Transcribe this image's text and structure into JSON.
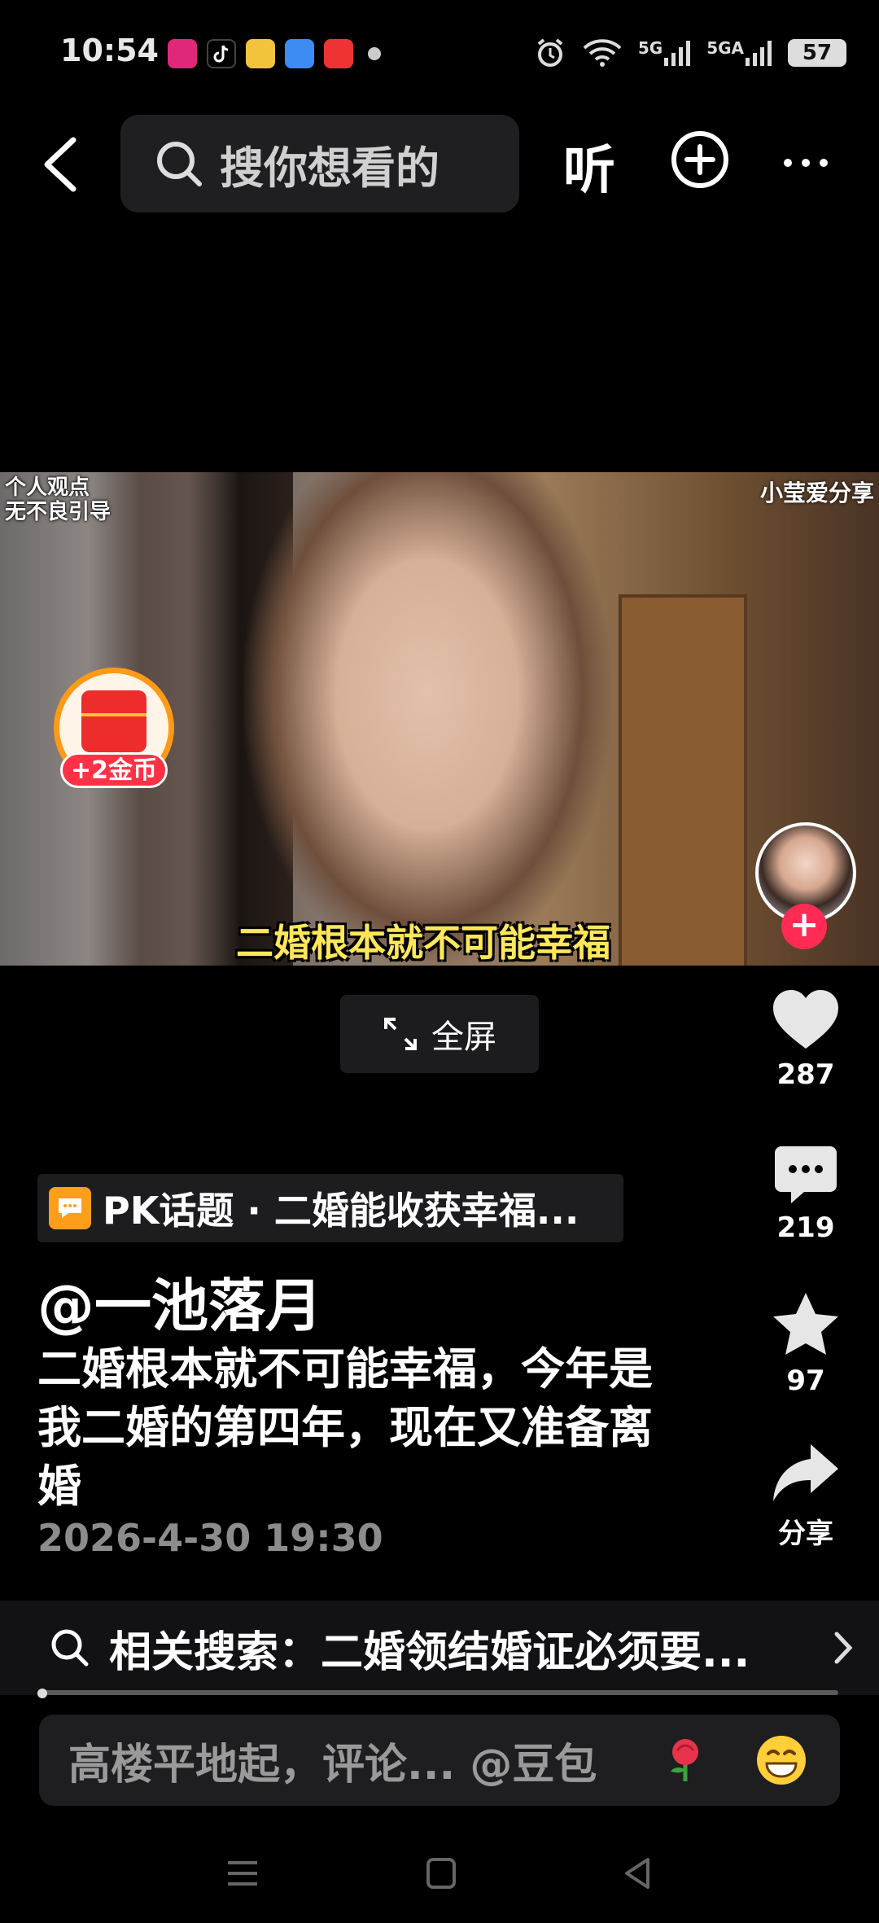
{
  "status_bar": {
    "time": "10:54",
    "net1": "5G",
    "net2": "5GA",
    "battery": "57"
  },
  "top_nav": {
    "search_placeholder": "搜你想看的",
    "listen_label": "听"
  },
  "video": {
    "corner_left_line1": "个人观点",
    "corner_left_line2": "无不良引导",
    "corner_right": "小莹爱分享",
    "subtitle": "二婚根本就不可能幸福",
    "coin_badge": "+2金币"
  },
  "fullscreen_label": "全屏",
  "actions": {
    "likes": "287",
    "comments": "219",
    "favorites": "97",
    "share_label": "分享"
  },
  "post": {
    "topic": "PK话题 · 二婚能收获幸福...",
    "author": "@一池落月",
    "description": "二婚根本就不可能幸福，今年是我二婚的第四年，现在又准备离婚",
    "date": "2026-4-30 19:30"
  },
  "related_search": "相关搜索：二婚领结婚证必须要...",
  "comment_bar": {
    "placeholder": "高楼平地起，评论... @豆包"
  },
  "colors": {
    "accent_red": "#fe2c55",
    "subtitle_yellow": "#ffe75a",
    "coin_orange": "#ff9a18"
  }
}
